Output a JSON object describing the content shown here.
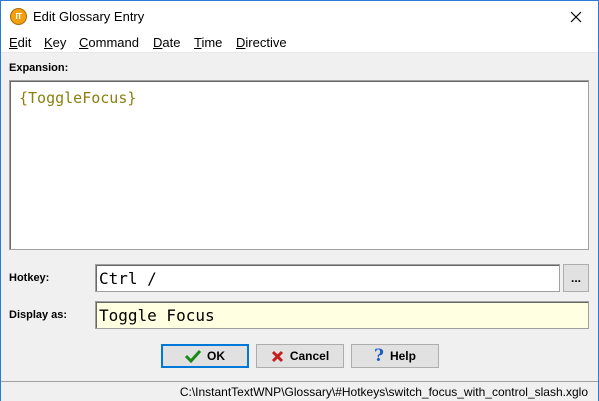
{
  "window": {
    "title": "Edit Glossary Entry",
    "icon_text": "IT"
  },
  "menu": [
    "Edit",
    "Key",
    "Command",
    "Date",
    "Time",
    "Directive"
  ],
  "expansion": {
    "label": "Expansion:",
    "value": "{ToggleFocus}"
  },
  "hotkey": {
    "label": "Hotkey:",
    "value": "Ctrl /",
    "browse_label": "..."
  },
  "display_as": {
    "label": "Display as:",
    "value": "Toggle Focus"
  },
  "buttons": {
    "ok": "OK",
    "cancel": "Cancel",
    "help": "Help"
  },
  "status": {
    "path": "C:\\InstantTextWNP\\Glossary\\#Hotkeys\\switch_focus_with_control_slash.xglo"
  },
  "colors": {
    "accent": "#0078d7",
    "expansion_text": "#8a7f10",
    "display_bg": "#ffffe1",
    "ok_check": "#1a8a1a",
    "cancel_x": "#c41e1e",
    "help_q": "#1a5fc4"
  }
}
